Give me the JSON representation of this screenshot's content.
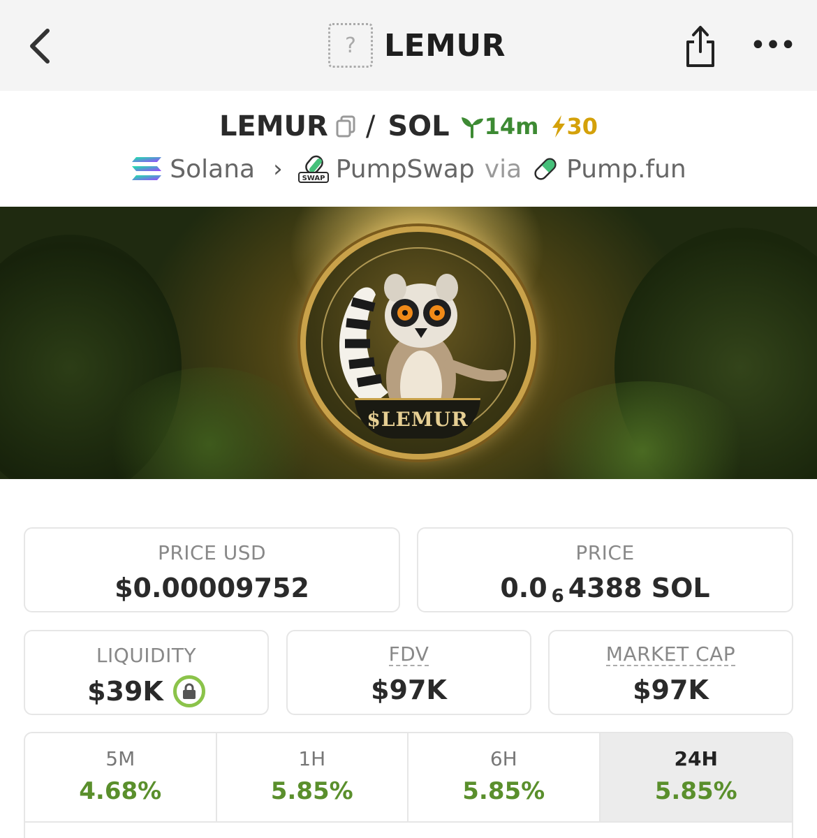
{
  "nav": {
    "title": "LEMUR",
    "token_placeholder_glyph": "?",
    "back_icon": "chevron-left-icon",
    "share_icon": "share-icon",
    "more_icon": "more-horizontal-icon",
    "more_glyph": "•••"
  },
  "pair": {
    "base": "LEMUR",
    "separator": "/",
    "quote": "SOL",
    "age": "14m",
    "boosts": "30",
    "age_color": "#3d8a33",
    "boost_color": "#d4a10a"
  },
  "route": {
    "chain": "Solana",
    "dex": "PumpSwap",
    "via": "via",
    "launchpad": "Pump.fun",
    "chevron": "›"
  },
  "banner": {
    "coin_text": "$LEMUR"
  },
  "stats": {
    "price_usd": {
      "label": "PRICE USD",
      "value": "$0.00009752"
    },
    "price": {
      "label": "PRICE",
      "value_prefix": "0.0",
      "value_sub": "6",
      "value_suffix": "4388 SOL"
    },
    "liquidity": {
      "label": "LIQUIDITY",
      "value": "$39K",
      "locked_icon": "lock-icon"
    },
    "fdv": {
      "label": "FDV",
      "value": "$97K"
    },
    "market_cap": {
      "label": "MARKET CAP",
      "value": "$97K"
    }
  },
  "timeframes": [
    {
      "label": "5M",
      "change": "4.68%"
    },
    {
      "label": "1H",
      "change": "5.85%"
    },
    {
      "label": "6H",
      "change": "5.85%"
    },
    {
      "label": "24H",
      "change": "5.85%",
      "active": true
    }
  ],
  "colors": {
    "positive": "#5a8f2c",
    "lock_ring": "#8bc34a"
  }
}
